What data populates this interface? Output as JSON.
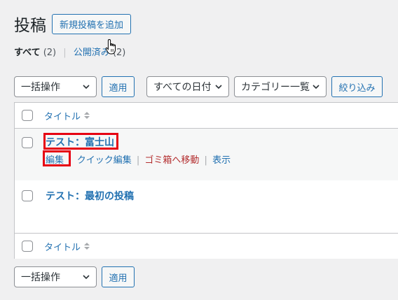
{
  "header": {
    "title": "投稿",
    "add_new_label": "新規投稿を追加"
  },
  "views": {
    "all_label": "すべて",
    "all_count": "(2)",
    "separator": "|",
    "published_label": "公開済み",
    "published_count": "(2)"
  },
  "tablenav_top": {
    "bulk_action": "一括操作",
    "apply_label": "適用",
    "date_filter": "すべての日付",
    "category_filter": "カテゴリー一覧",
    "filter_label": "絞り込み"
  },
  "table": {
    "title_column": "タイトル",
    "rows": [
      {
        "title": "テスト：富士山",
        "actions": {
          "edit": "編集",
          "quick_edit": "クイック編集",
          "trash": "ゴミ箱へ移動",
          "view": "表示",
          "separator": "|"
        }
      },
      {
        "title": "テスト：最初の投稿"
      }
    ]
  },
  "tablenav_bottom": {
    "bulk_action": "一括操作",
    "apply_label": "適用"
  },
  "colors": {
    "accent": "#2271b1",
    "highlight": "#e60012",
    "trash": "#b32d2e"
  }
}
